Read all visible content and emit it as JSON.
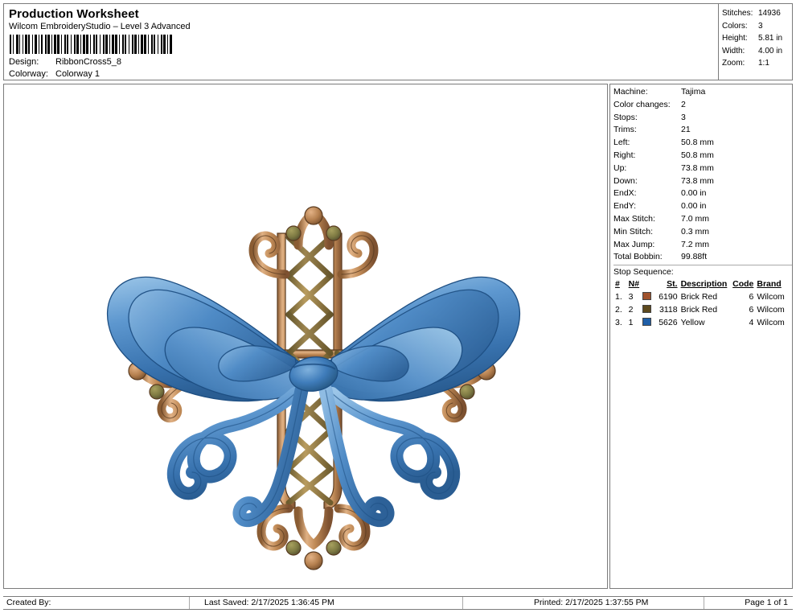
{
  "header": {
    "title": "Production Worksheet",
    "subtitle": "Wilcom EmbroideryStudio – Level 3 Advanced",
    "barcode_icon": "barcode",
    "design_label": "Design:",
    "design_value": "RibbonCross5_8",
    "colorway_label": "Colorway:",
    "colorway_value": "Colorway 1",
    "stats": [
      {
        "label": "Stitches:",
        "value": "14936"
      },
      {
        "label": "Colors:",
        "value": "3"
      },
      {
        "label": "Height:",
        "value": "5.81 in"
      },
      {
        "label": "Width:",
        "value": "4.00 in"
      },
      {
        "label": "Zoom:",
        "value": "1:1"
      }
    ]
  },
  "info": {
    "rows": [
      {
        "label": "Machine:",
        "value": "Tajima"
      },
      {
        "label": "Color changes:",
        "value": "2"
      },
      {
        "label": "Stops:",
        "value": "3"
      },
      {
        "label": "Trims:",
        "value": "21"
      },
      {
        "label": "Left:",
        "value": "50.8 mm"
      },
      {
        "label": "Right:",
        "value": "50.8 mm"
      },
      {
        "label": "Up:",
        "value": "73.8 mm"
      },
      {
        "label": "Down:",
        "value": "73.8 mm"
      },
      {
        "label": "EndX:",
        "value": "0.00 in"
      },
      {
        "label": "EndY:",
        "value": "0.00 in"
      },
      {
        "label": "Max Stitch:",
        "value": "7.0 mm"
      },
      {
        "label": "Min Stitch:",
        "value": "0.3 mm"
      },
      {
        "label": "Max Jump:",
        "value": "7.2 mm"
      },
      {
        "label": "Total Bobbin:",
        "value": "99.88ft"
      }
    ],
    "stop_sequence_label": "Stop Sequence:",
    "stop_table": {
      "headers": [
        "#",
        "N#",
        "",
        "St.",
        "Description",
        "Code",
        "Brand"
      ],
      "rows": [
        {
          "num": "1.",
          "n": "3",
          "color": "#a0522d",
          "stitches": "6190",
          "description": "Brick Red",
          "code": "6",
          "brand": "Wilcom"
        },
        {
          "num": "2.",
          "n": "2",
          "color": "#5e4a1e",
          "stitches": "3118",
          "description": "Brick Red",
          "code": "6",
          "brand": "Wilcom"
        },
        {
          "num": "3.",
          "n": "1",
          "color": "#1f5fa8",
          "stitches": "5626",
          "description": "Yellow",
          "code": "4",
          "brand": "Wilcom"
        }
      ]
    }
  },
  "design": {
    "name": "RibbonCross5_8",
    "alt": "Ornate filigree cross with blue ribbon bow embroidery design",
    "colors": {
      "metal_light": "#d9a46f",
      "metal_mid": "#b07a4a",
      "metal_dark": "#8a5c33",
      "metal_outline": "#5a3b20",
      "lattice": "#7a6a3a",
      "bead_olive": "#7e7a43",
      "bead_tan": "#b08050",
      "ribbon_light": "#79afdd",
      "ribbon_mid": "#4a86c4",
      "ribbon_dark": "#2f6ba8",
      "ribbon_outline": "#1d4e82"
    }
  },
  "footer": {
    "created_by": "Created By:",
    "last_saved": "Last Saved: 2/17/2025 1:36:45 PM",
    "printed": "Printed: 2/17/2025 1:37:55 PM",
    "page": "Page 1 of 1"
  }
}
